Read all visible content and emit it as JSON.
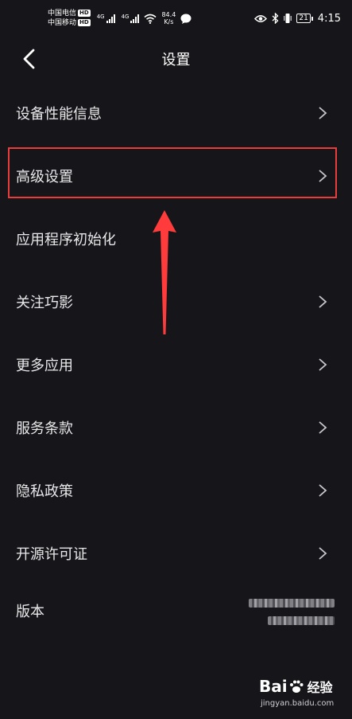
{
  "status_bar": {
    "carrier1": "中国电信",
    "carrier2": "中国移动",
    "hd": "HD",
    "net1": "4G",
    "net2": "4G",
    "speed_value": "84.4",
    "speed_unit": "K/s",
    "battery": "21",
    "time": "4:15"
  },
  "nav": {
    "title": "设置"
  },
  "menu": {
    "items": [
      {
        "label": "设备性能信息",
        "has_chevron": true
      },
      {
        "label": "高级设置",
        "has_chevron": true
      },
      {
        "label": "应用程序初始化",
        "has_chevron": false
      },
      {
        "label": "关注巧影",
        "has_chevron": true
      },
      {
        "label": "更多应用",
        "has_chevron": true
      },
      {
        "label": "服务条款",
        "has_chevron": true
      },
      {
        "label": "隐私政策",
        "has_chevron": true
      },
      {
        "label": "开源许可证",
        "has_chevron": true
      }
    ],
    "version_label": "版本"
  },
  "annotation": {
    "highlight_color": "#e83d3d",
    "arrow_color": "#ff3b3b"
  },
  "watermark": {
    "brand_a": "Bai",
    "brand_b": "经验",
    "url": "jingyan.baidu.com"
  },
  "theme": {
    "background": "#16161a",
    "text": "#e8e8ea",
    "chevron": "#c8c8cc"
  }
}
